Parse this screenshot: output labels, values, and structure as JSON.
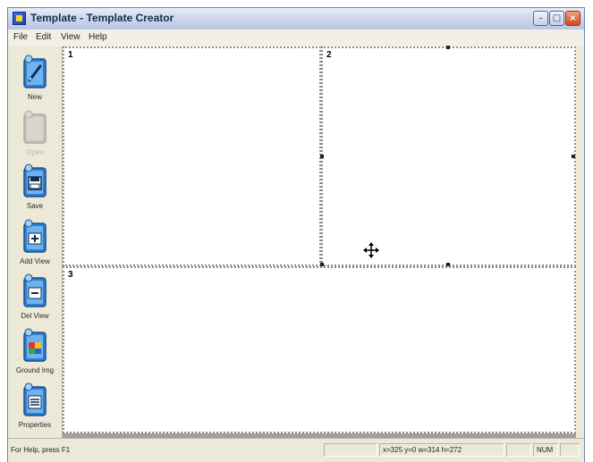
{
  "window": {
    "title": "Template - Template Creator",
    "controls": {
      "minimize": "–",
      "maximize": "□",
      "close": "×"
    }
  },
  "menubar": {
    "items": [
      {
        "label": "File"
      },
      {
        "label": "Edit"
      },
      {
        "label": "View"
      },
      {
        "label": "Help"
      }
    ]
  },
  "toolbar": {
    "items": [
      {
        "label": "New",
        "icon": "pen-icon",
        "enabled": true
      },
      {
        "label": "Open",
        "icon": "folder-icon",
        "enabled": false
      },
      {
        "label": "Save",
        "icon": "floppy-disk-icon",
        "enabled": true
      },
      {
        "label": "Add View",
        "icon": "add-view-icon",
        "enabled": true
      },
      {
        "label": "Del View",
        "icon": "delete-view-icon",
        "enabled": true
      },
      {
        "label": "Ground Img",
        "icon": "image-icon",
        "enabled": true
      },
      {
        "label": "Properties",
        "icon": "properties-icon",
        "enabled": true
      }
    ],
    "accent": "#2f7fd0"
  },
  "workspace": {
    "panes": [
      {
        "label": "1"
      },
      {
        "label": "2"
      },
      {
        "label": "3"
      }
    ]
  },
  "statusbar": {
    "help_text": "For Help, press F1",
    "coords": "x=325 y=0 w=314 h=272",
    "num": "NUM"
  }
}
